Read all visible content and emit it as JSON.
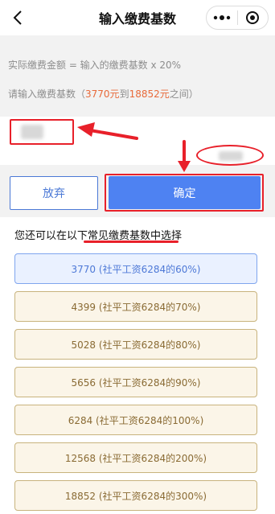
{
  "header": {
    "title": "输入缴费基数",
    "back_icon": "chevron-left-icon",
    "more_icon": "more-dots-icon",
    "close_icon": "target-circle-icon"
  },
  "formula": "实际缴费金额 = 输入的缴费基数 x 20%",
  "hint": {
    "prefix": "请输入缴费基数（",
    "min": "3770元",
    "middle": "到",
    "max": "18852元",
    "suffix": "之间）"
  },
  "buttons": {
    "give_up": "放弃",
    "confirm": "确定"
  },
  "select_prompt": "您还可以在以下常见缴费基数中选择",
  "options": [
    {
      "label": "3770 (社平工资6284的60%)",
      "selected": true
    },
    {
      "label": "4399 (社平工资6284的70%)",
      "selected": false
    },
    {
      "label": "5028 (社平工资6284的80%)",
      "selected": false
    },
    {
      "label": "5656 (社平工资6284的90%)",
      "selected": false
    },
    {
      "label": "6284 (社平工资6284的100%)",
      "selected": false
    },
    {
      "label": "12568 (社平工资6284的200%)",
      "selected": false
    },
    {
      "label": "18852 (社平工资6284的300%)",
      "selected": false
    }
  ],
  "colors": {
    "primary": "#4e82f2",
    "annotation_red": "#e8202a",
    "range_highlight": "#e86a3a",
    "option_bg": "#fbf5e8",
    "option_border": "#c8b37d",
    "selected_bg": "#eaf1ff"
  }
}
